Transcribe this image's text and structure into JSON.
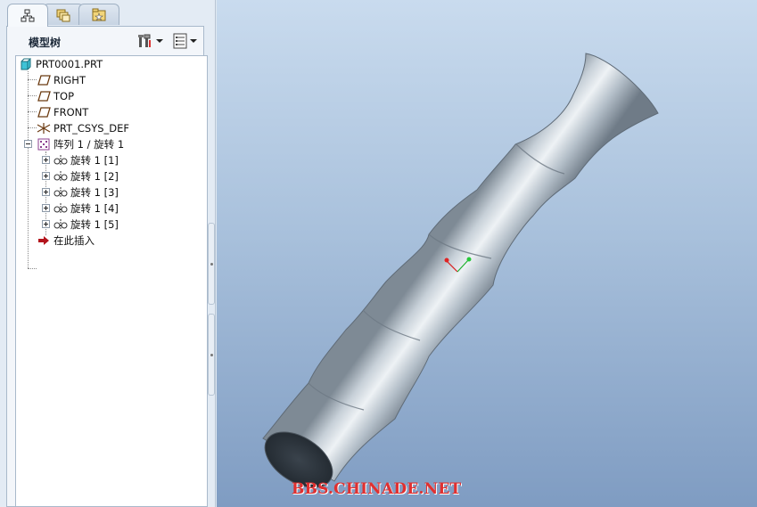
{
  "left_panel": {
    "tabs": [
      {
        "icon": "model-tree-icon"
      },
      {
        "icon": "folder-browser-icon"
      },
      {
        "icon": "favorites-icon"
      }
    ],
    "title": "模型树",
    "settings_icon": "tree-settings-icon",
    "show_icon": "tree-show-icon"
  },
  "tree": {
    "root": "PRT0001.PRT",
    "items": [
      {
        "label": "RIGHT",
        "icon": "datum-plane-icon"
      },
      {
        "label": "TOP",
        "icon": "datum-plane-icon"
      },
      {
        "label": "FRONT",
        "icon": "datum-plane-icon"
      },
      {
        "label": "PRT_CSYS_DEF",
        "icon": "csys-icon"
      },
      {
        "label": "阵列 1 / 旋转 1",
        "icon": "pattern-icon"
      },
      {
        "label": "旋转 1 [1]",
        "icon": "revolve-icon"
      },
      {
        "label": "旋转 1 [2]",
        "icon": "revolve-icon"
      },
      {
        "label": "旋转 1 [3]",
        "icon": "revolve-icon"
      },
      {
        "label": "旋转 1 [4]",
        "icon": "revolve-icon"
      },
      {
        "label": "旋转 1 [5]",
        "icon": "revolve-icon"
      },
      {
        "label": "在此插入",
        "icon": "insert-here-arrow-icon"
      }
    ]
  },
  "viewport": {
    "watermark": "BBS.CHINADE.NET",
    "background_top": "#c9dbee",
    "background_bottom": "#7f9cc2",
    "model_color": "#b9c3cc"
  }
}
